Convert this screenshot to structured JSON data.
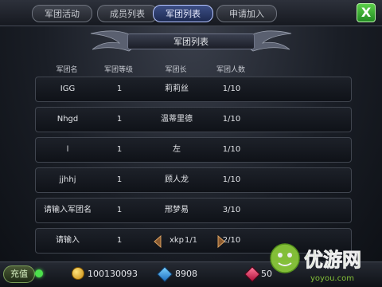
{
  "tabs": [
    {
      "label": "军团活动"
    },
    {
      "label": "成员列表"
    },
    {
      "label": "军团列表"
    },
    {
      "label": "申请加入"
    }
  ],
  "close_label": "X",
  "title": "军团列表",
  "table": {
    "headers": [
      "军团名",
      "军团等级",
      "军团长",
      "军团人数"
    ],
    "rows": [
      {
        "name": "IGG",
        "level": "1",
        "leader": "莉莉丝",
        "members": "1/10"
      },
      {
        "name": "Nhgd",
        "level": "1",
        "leader": "温蒂里德",
        "members": "1/10"
      },
      {
        "name": "l",
        "level": "1",
        "leader": "左",
        "members": "1/10"
      },
      {
        "name": "jjhhj",
        "level": "1",
        "leader": "顾人龙",
        "members": "1/10"
      },
      {
        "name": "请输入军团名",
        "level": "1",
        "leader": "邢梦易",
        "members": "3/10"
      },
      {
        "name": "请输入",
        "level": "1",
        "leader": "xkp",
        "members": "2/10"
      }
    ]
  },
  "pager": {
    "text": "1/1"
  },
  "bottom": {
    "recharge_label": "充值",
    "coins": "100130093",
    "gems": "8908",
    "rubies": "50"
  },
  "watermark": {
    "brand": "优游网",
    "url": "yoyou.com"
  },
  "colors": {
    "active_tab": "#3d4f86",
    "close_button": "#3fae38",
    "watermark": "#8ccc3a"
  }
}
